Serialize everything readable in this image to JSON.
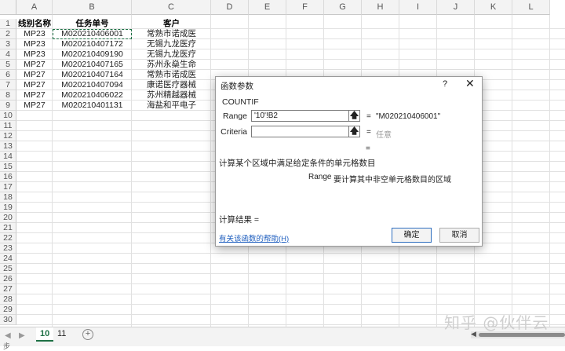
{
  "columns": [
    "A",
    "B",
    "C",
    "D",
    "E",
    "F",
    "G",
    "H",
    "I",
    "J",
    "K",
    "L"
  ],
  "rows": [
    "1",
    "2",
    "3",
    "4",
    "5",
    "6",
    "7",
    "8",
    "9",
    "10",
    "11",
    "12",
    "13",
    "14",
    "15",
    "16",
    "17",
    "18",
    "19",
    "20",
    "21",
    "22",
    "23",
    "24",
    "25",
    "26",
    "27",
    "28",
    "29",
    "30"
  ],
  "header_row": [
    "线别名称",
    "任务单号",
    "客户"
  ],
  "data_rows": [
    [
      "MP23",
      "M020210406001",
      "常熟市诺成医"
    ],
    [
      "MP23",
      "M020210407172",
      "无锡九龙医疗"
    ],
    [
      "MP23",
      "M020210409190",
      "无锡九龙医疗"
    ],
    [
      "MP27",
      "M020210407165",
      "苏州永燊生命"
    ],
    [
      "MP27",
      "M020210407164",
      "常熟市诺成医"
    ],
    [
      "MP27",
      "M020210407094",
      "康诺医疗器械"
    ],
    [
      "MP27",
      "M020210406022",
      "苏州精越器械"
    ],
    [
      "MP27",
      "M020210401131",
      "海盐和平电子"
    ]
  ],
  "sheet_tabs": {
    "tab1": "10",
    "tab2": "11",
    "nav_left": "◀",
    "nav_right": "▶",
    "add": "+"
  },
  "dialog": {
    "title": "函数参数",
    "help": "?",
    "close": "✕",
    "function_name": "COUNTIF",
    "arg1_label": "Range",
    "arg1_value": "'10'!B2",
    "arg1_result": "\"M020210406001\"",
    "arg2_label": "Criteria",
    "arg2_value": "",
    "arg2_result": "任意",
    "eq": "=",
    "description": "计算某个区域中满足给定条件的单元格数目",
    "param_name": "Range",
    "param_desc": "要计算其中非空单元格数目的区域",
    "result_label": "计算结果 =",
    "help_link": "有关该函数的帮助(H)",
    "ok": "确定",
    "cancel": "取消"
  },
  "watermark": "知乎 @伙伴云",
  "status_text": "步"
}
